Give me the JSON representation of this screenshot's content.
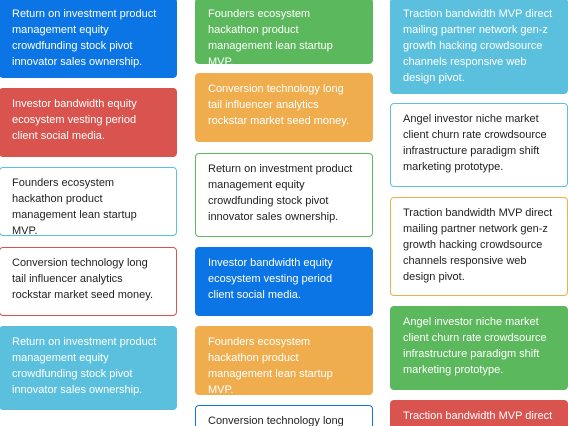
{
  "colors": {
    "primary": "#0b75e6",
    "success": "#5cb85c",
    "info": "#5bc0de",
    "danger": "#d9534f",
    "warning": "#f0ad4e"
  },
  "columns": [
    {
      "cards": [
        {
          "text": "Return on investment product management equity crowdfunding stock pivot innovator sales ownership.",
          "style": "solid-blue"
        },
        {
          "text": "Investor bandwidth equity ecosystem vesting period client social media.",
          "style": "solid-red"
        },
        {
          "text": "Founders ecosystem hackathon product management lean startup MVP.",
          "style": "outline-cyan"
        },
        {
          "text": "Conversion technology long tail influencer analytics rockstar market seed money.",
          "style": "outline-red"
        },
        {
          "text": "Return on investment product management equity crowdfunding stock pivot innovator sales ownership.",
          "style": "solid-cyan"
        }
      ]
    },
    {
      "cards": [
        {
          "text": "Founders ecosystem hackathon product management lean startup MVP.",
          "style": "solid-green"
        },
        {
          "text": "Conversion technology long tail influencer analytics rockstar market seed money.",
          "style": "solid-orange"
        },
        {
          "text": "Return on investment product management equity crowdfunding stock pivot innovator sales ownership.",
          "style": "outline-green"
        },
        {
          "text": "Investor bandwidth equity ecosystem vesting period client social media.",
          "style": "solid-blue"
        },
        {
          "text": "Founders ecosystem hackathon product management lean startup MVP.",
          "style": "solid-orange"
        },
        {
          "text": "Conversion technology long tail",
          "style": "outline-blue"
        }
      ]
    },
    {
      "cards": [
        {
          "text": "Traction bandwidth MVP direct mailing partner network gen-z growth hacking crowdsource channels responsive web design pivot.",
          "style": "solid-cyan"
        },
        {
          "text": "Angel investor niche market client churn rate crowdsource infrastructure paradigm shift marketing prototype.",
          "style": "outline-cyan"
        },
        {
          "text": "Traction bandwidth MVP direct mailing partner network gen-z growth hacking crowdsource channels responsive web design pivot.",
          "style": "outline-orange"
        },
        {
          "text": "Angel investor niche market client churn rate crowdsource infrastructure paradigm shift marketing prototype.",
          "style": "solid-green"
        },
        {
          "text": "Traction bandwidth MVP direct",
          "style": "solid-red"
        }
      ]
    }
  ]
}
